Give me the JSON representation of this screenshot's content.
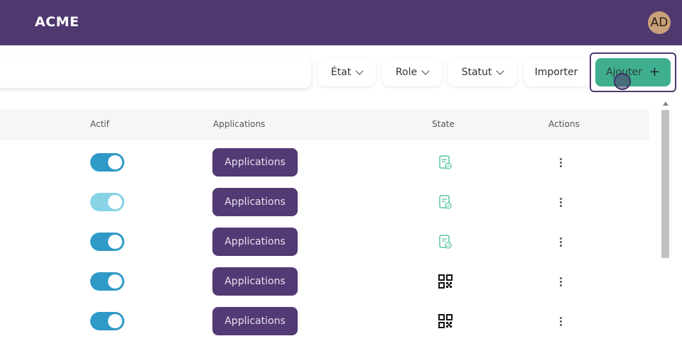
{
  "header": {
    "brand": "ACME",
    "avatar_initials": "AD"
  },
  "toolbar": {
    "search_value": "",
    "filters": [
      {
        "label": "État"
      },
      {
        "label": "Role"
      },
      {
        "label": "Statut"
      }
    ],
    "import_label": "Importer",
    "add_label": "Ajouter"
  },
  "table": {
    "headers": {
      "actif": "Actif",
      "applications": "Applications",
      "state": "State",
      "actions": "Actions"
    },
    "rows": [
      {
        "actif": true,
        "applications_label": "Applications",
        "state_icon": "document-check-icon"
      },
      {
        "actif": true,
        "applications_label": "Applications",
        "state_icon": "document-check-icon"
      },
      {
        "actif": true,
        "applications_label": "Applications",
        "state_icon": "document-check-icon"
      },
      {
        "actif": true,
        "applications_label": "Applications",
        "state_icon": "qr-code-icon"
      },
      {
        "actif": true,
        "applications_label": "Applications",
        "state_icon": "qr-code-icon"
      }
    ]
  },
  "colors": {
    "brand": "#4f386e",
    "accent_green": "#3fae8e",
    "toggle_on": "#2f9ac7",
    "state_teal": "#5cc3a6"
  }
}
